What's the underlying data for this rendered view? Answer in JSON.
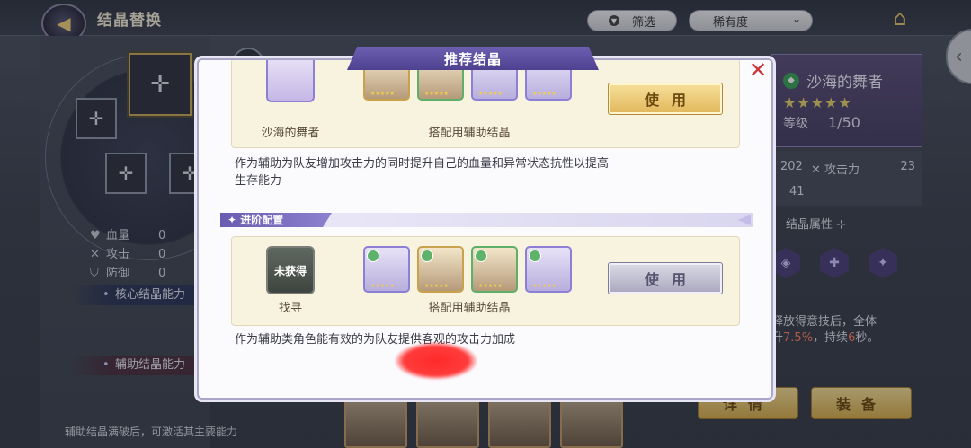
{
  "header": {
    "title": "结晶替换",
    "filter_label": "筛选",
    "rarity_label": "稀有度"
  },
  "left": {
    "stats": [
      {
        "label": "血量",
        "value": "0",
        "icon": "heart-icon"
      },
      {
        "label": "攻击",
        "value": "0",
        "icon": "swords-icon"
      },
      {
        "label": "防御",
        "value": "0",
        "icon": "shield-icon"
      }
    ],
    "core_band": "核心结晶能力",
    "aux_band": "辅助结晶能力",
    "hint": "辅助结晶满破后，可激活其主要能力"
  },
  "right": {
    "name": "沙海的舞者",
    "stars": "★★★★★",
    "level_label": "等级",
    "level_value": "1/50",
    "stat_hp": "202",
    "stat_atk_label": "攻击力",
    "stat_atk": "23",
    "stat_def": "41",
    "attr_label": "结晶属性",
    "skill_line1": "释放得意技后，全体",
    "skill_line2_pre": "升",
    "skill_pct": "7.5%",
    "skill_mid": "，持续",
    "skill_sec": "6",
    "skill_post": "秒。",
    "detail_btn": "详情",
    "equip_btn": "装备"
  },
  "modal": {
    "title": "推荐结晶",
    "config1": {
      "char_label": "沙海的舞者",
      "aux_label": "搭配用辅助结晶",
      "use_label": "使用",
      "description": "作为辅助为队友增加攻击力的同时提升自己的血量和异常状态抗性以提高生存能力"
    },
    "advanced_label": "进阶配置",
    "config2": {
      "char_label": "找寻",
      "char_status": "未获得",
      "aux_label": "搭配用辅助结晶",
      "use_label": "使用",
      "description": "作为辅助类角色能有效的为队友提供客观的攻击力加成"
    }
  },
  "colors": {
    "modal_title_bg": "#5a4d9c",
    "use_gold": "#e1b65a",
    "use_gray": "#a9a7bd",
    "close_red": "#c9353b"
  }
}
